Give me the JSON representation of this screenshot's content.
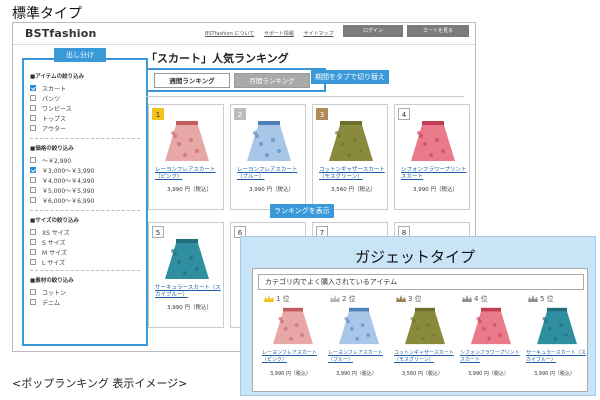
{
  "labels": {
    "standard_type": "標準タイプ",
    "gadget_type": "ガジェットタイプ",
    "caption": "<ポップランキング 表示イメージ>"
  },
  "site": {
    "logo": "BSTfashion",
    "links": [
      "BSTfashion について",
      "サポート情報",
      "サイトマップ"
    ],
    "login_button": "ログイン",
    "cart_button": "カートを見る"
  },
  "sidebar": {
    "heading": "出し分け",
    "groups": [
      {
        "title": "■アイテムの絞り込み",
        "options": [
          {
            "label": "スカート",
            "checked": true
          },
          {
            "label": "パンツ",
            "checked": false
          },
          {
            "label": "ワンピース",
            "checked": false
          },
          {
            "label": "トップス",
            "checked": false
          },
          {
            "label": "アウター",
            "checked": false
          }
        ]
      },
      {
        "title": "■価格の絞り込み",
        "options": [
          {
            "label": "～￥2,990",
            "checked": false
          },
          {
            "label": "￥3,000～￥3,990",
            "checked": true
          },
          {
            "label": "￥4,000～￥4,990",
            "checked": false
          },
          {
            "label": "￥5,000～￥5,990",
            "checked": false
          },
          {
            "label": "￥6,000～￥6,990",
            "checked": false
          }
        ]
      },
      {
        "title": "■サイズの絞り込み",
        "options": [
          {
            "label": "XS サイズ",
            "checked": false
          },
          {
            "label": "S サイズ",
            "checked": false
          },
          {
            "label": "M サイズ",
            "checked": false
          },
          {
            "label": "L サイズ",
            "checked": false
          }
        ]
      },
      {
        "title": "■素材の絞り込み",
        "options": [
          {
            "label": "コットン",
            "checked": false
          },
          {
            "label": "デニム",
            "checked": false
          }
        ]
      }
    ]
  },
  "main": {
    "title": "「スカート」人気ランキング",
    "tabs": [
      "週間ランキング",
      "月間ランキング"
    ],
    "tab_callout": "期間をタブで切り替え",
    "rank_callout": "ランキングを表示",
    "products": [
      {
        "rank": "1",
        "name": "レーヨンフレアスカート（ピンク）",
        "price": "3,990 円（税込）",
        "color": "#e8a7a7",
        "pattern": "#c45c5c"
      },
      {
        "rank": "2",
        "name": "レーヨンフレアスカート（ブルー）",
        "price": "3,990 円（税込）",
        "color": "#a7c6e8",
        "pattern": "#4d7fb8"
      },
      {
        "rank": "3",
        "name": "コットンギャザースカート（モスグリーン）",
        "price": "3,560 円（税込）",
        "color": "#8a8a3c",
        "pattern": "#6f6f2c"
      },
      {
        "rank": "4",
        "name": "シフォンフラワープリントスカート",
        "price": "3,990 円（税込）",
        "color": "#e87a8a",
        "pattern": "#c43c52"
      },
      {
        "rank": "5",
        "name": "サーキュラースカート（スカイブルー）",
        "price": "3,990 円（税込）",
        "color": "#2f8fa0",
        "pattern": "#1f6d7c"
      },
      {
        "rank": "6",
        "name": "",
        "price": "",
        "color": "#d5d5d5",
        "pattern": "#bbbbbb"
      },
      {
        "rank": "7",
        "name": "",
        "price": "",
        "color": "#2c3e5c",
        "pattern": "#1c2b44"
      },
      {
        "rank": "8",
        "name": "",
        "price": "",
        "color": "#d5d5d5",
        "pattern": "#bbbbbb"
      }
    ]
  },
  "gadget": {
    "heading": "カテゴリ内でよく購入されているアイテム",
    "items": [
      {
        "rank": "1 位",
        "name": "レーヨンフレアスカート（ピンク）",
        "price": "3,990 円（税込）",
        "color": "#e8a7a7",
        "pattern": "#c45c5c",
        "crown": "#f3c31c"
      },
      {
        "rank": "2 位",
        "name": "レーヨンフレアスカート（ブルー）",
        "price": "3,990 円（税込）",
        "color": "#a7c6e8",
        "pattern": "#4d7fb8",
        "crown": "#b5b5b5"
      },
      {
        "rank": "3 位",
        "name": "コットンギャザースカート（モスグリーン）",
        "price": "3,560 円（税込）",
        "color": "#8a8a3c",
        "pattern": "#6f6f2c",
        "crown": "#9c8357"
      },
      {
        "rank": "4 位",
        "name": "シフォンフラワープリントスカート",
        "price": "3,990 円（税込）",
        "color": "#e87a8a",
        "pattern": "#c43c52",
        "crown": "#8f8f8f"
      },
      {
        "rank": "5 位",
        "name": "サーキュラースカート（スカイブルー）",
        "price": "3,990 円（税込）",
        "color": "#2f8fa0",
        "pattern": "#1f6d7c",
        "crown": "#8f8f8f"
      }
    ]
  },
  "colors": {
    "accent": "#3a9ad9",
    "gadget_bg": "#c9e3f7",
    "link": "#1e5ea8"
  }
}
